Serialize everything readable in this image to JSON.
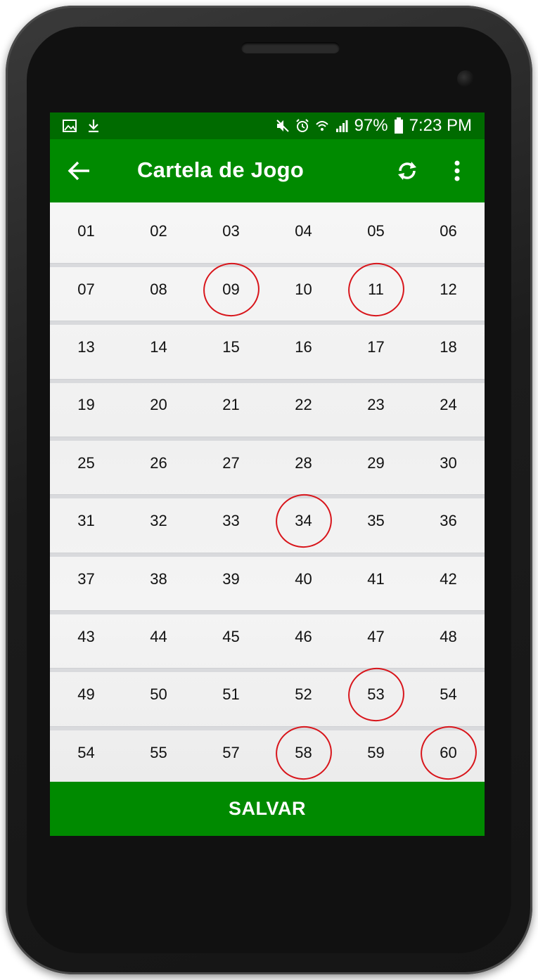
{
  "status_bar": {
    "battery": "97%",
    "time": "7:23 PM",
    "icons_left": [
      "image-icon",
      "download-icon"
    ],
    "icons_right": [
      "mute-icon",
      "alarm-icon",
      "wifi-icon",
      "signal-icon",
      "battery-icon"
    ]
  },
  "app_bar": {
    "title": "Cartela de Jogo",
    "back_icon": "arrow-back-icon",
    "refresh_icon": "refresh-icon",
    "more_icon": "more-vert-icon"
  },
  "card": {
    "numbers": [
      "01",
      "02",
      "03",
      "04",
      "05",
      "06",
      "07",
      "08",
      "09",
      "10",
      "11",
      "12",
      "13",
      "14",
      "15",
      "16",
      "17",
      "18",
      "19",
      "20",
      "21",
      "22",
      "23",
      "24",
      "25",
      "26",
      "27",
      "28",
      "29",
      "30",
      "31",
      "32",
      "33",
      "34",
      "35",
      "36",
      "37",
      "38",
      "39",
      "40",
      "41",
      "42",
      "43",
      "44",
      "45",
      "46",
      "47",
      "48",
      "49",
      "50",
      "51",
      "52",
      "53",
      "54",
      "54",
      "55",
      "57",
      "58",
      "59",
      "60"
    ],
    "selected": [
      "09",
      "11",
      "34",
      "53",
      "58",
      "60"
    ],
    "circle_color": "#d8151b"
  },
  "actions": {
    "save_label": "SALVAR"
  },
  "colors": {
    "status_bar": "#006b00",
    "primary": "#008a00"
  }
}
